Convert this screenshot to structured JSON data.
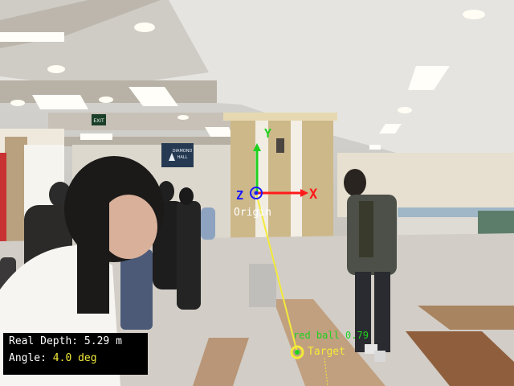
{
  "scene": {
    "signage": {
      "exit_sign": "EXIT",
      "direction_sign_line1": "DIAMOND",
      "direction_sign_line2": "HALL"
    }
  },
  "overlay": {
    "axes": {
      "x_label": "X",
      "y_label": "Y",
      "z_label": "Z",
      "origin_label": "Origin"
    },
    "detection": {
      "label": "red ball",
      "confidence": "0.79",
      "target_label": "Target"
    },
    "info": {
      "depth_label": "Real Depth:",
      "depth_value": "5.29",
      "depth_unit": "m",
      "angle_label": "Angle:",
      "angle_value": "4.0",
      "angle_unit": "deg"
    },
    "colors": {
      "x_axis": "#ff1a1a",
      "y_axis": "#1fd11f",
      "z_axis": "#1a1aff",
      "track_line": "#f3ea3a",
      "detection_text": "#1fd11f",
      "info_bg": "#000000"
    }
  }
}
